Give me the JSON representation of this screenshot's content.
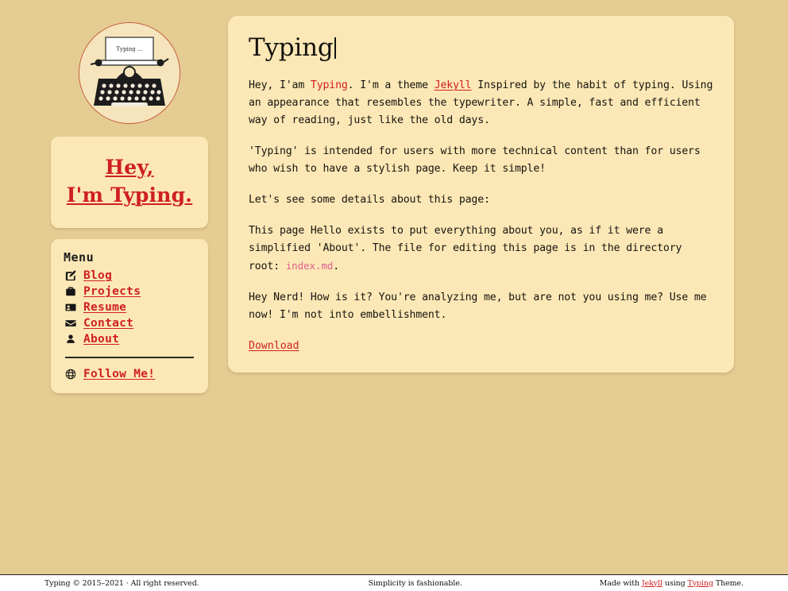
{
  "theme": {
    "background_color": "#e5cc92",
    "card_color": "#fce8b6",
    "accent_red": "#cf1f22",
    "code_pink": "#e0608f",
    "text_color": "#16140f"
  },
  "sidebar": {
    "avatar": {
      "icon": "typewriter-logo",
      "paper_text": "Typing ..."
    },
    "name_lines": [
      "Hey,",
      "I'm Typing."
    ],
    "menu_title": "Menu",
    "menu_items": [
      {
        "label": "Blog",
        "icon": "pen-square-icon"
      },
      {
        "label": "Projects",
        "icon": "briefcase-icon"
      },
      {
        "label": "Resume",
        "icon": "id-card-icon"
      },
      {
        "label": "Contact",
        "icon": "envelope-icon"
      },
      {
        "label": "About",
        "icon": "user-icon"
      }
    ],
    "follow": {
      "label": "Follow Me!",
      "icon": "globe-icon"
    }
  },
  "main": {
    "title": "Typing",
    "paragraph1": {
      "part1": "Hey, I'am ",
      "link1": "Typing",
      "part2": ". I'm a theme ",
      "link2": "Jekyll",
      "part3": " Inspired by the habit of typing. Using an appearance that resembles the typewriter. A simple, fast and efficient way of reading, just like the old days."
    },
    "paragraph2": "'Typing' is intended for users with more technical content than for users who wish to have a stylish page. Keep it simple!",
    "paragraph3": "Let's see some details about this page:",
    "paragraph4": {
      "part1": "This page Hello exists to put everything about you, as if it were a simplified 'About'. The file for editing this page is in the directory root: ",
      "code": "index.md",
      "part2": "."
    },
    "paragraph5": "Hey Nerd! How is it? You're analyzing me, but are not you using me? Use me now! I'm not into embellishment.",
    "download_label": "Download"
  },
  "footer": {
    "left": "Typing © 2015–2021 · All right reserved.",
    "center": "Simplicity is fashionable.",
    "right": {
      "part1": "Made with ",
      "link1": "Jekyll",
      "part2": " using ",
      "link2": "Typing",
      "part3": " Theme."
    }
  }
}
